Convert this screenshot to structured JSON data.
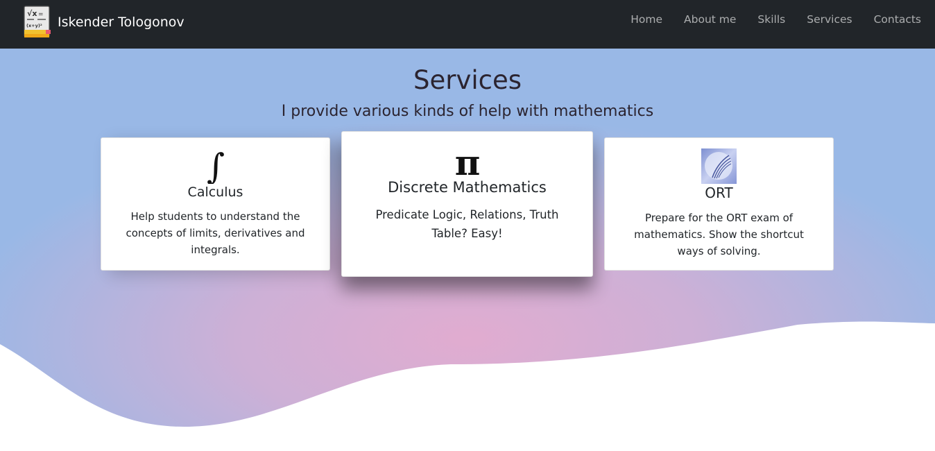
{
  "nav": {
    "brand": "Iskender Tologonov",
    "logo_icon": "math-notebook-icon",
    "links": [
      "Home",
      "About me",
      "Skills",
      "Services",
      "Contacts"
    ]
  },
  "hero": {
    "title": "Services",
    "subtitle": "I provide various kinds of help with mathematics"
  },
  "services": [
    {
      "icon": "integral-icon",
      "title": "Calculus",
      "text": "Help students to understand the concepts of limits, derivatives and integrals."
    },
    {
      "icon": "pi-icon",
      "title": "Discrete Mathematics",
      "text": "Predicate Logic, Relations, Truth Table? Easy!"
    },
    {
      "icon": "ort-logo-icon",
      "title": "ORT",
      "text": "Prepare for the ORT exam of mathematics. Show the shortcut ways of solving."
    }
  ],
  "colors": {
    "navbar": "#212529",
    "hero_center": "#dcaed0",
    "hero_edge": "#97b9e6"
  }
}
